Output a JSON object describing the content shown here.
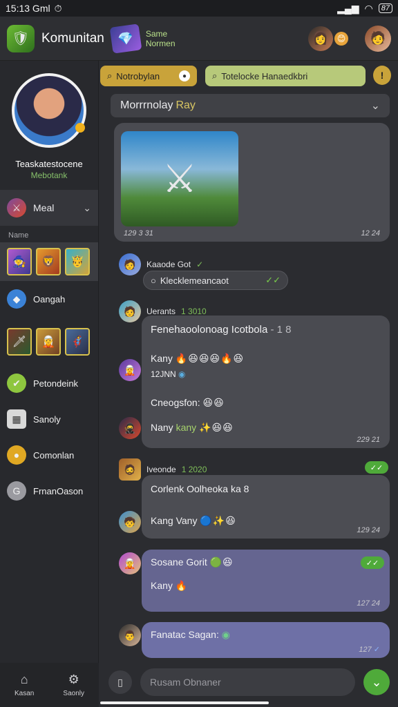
{
  "status": {
    "time": "15:13 Gml",
    "battery": "87"
  },
  "header": {
    "title": "Komunitan",
    "game_line1": "Same",
    "game_line2": "Normen"
  },
  "sidebar": {
    "name": "Teaskatestocene",
    "subtitle": "Mebotank",
    "meal_label": "Meal",
    "section_label": "Name",
    "items": [
      {
        "label": "Oangah",
        "icon": "diamond-icon",
        "color": "#3b82d6"
      },
      {
        "label": "Petondeink",
        "icon": "check-icon",
        "color": "#8ec63f"
      },
      {
        "label": "Sanoly",
        "icon": "calendar-icon",
        "color": "#d9d9d9"
      },
      {
        "label": "Comonlan",
        "icon": "trophy-icon",
        "color": "#e0a823"
      },
      {
        "label": "FrnanOason",
        "icon": "lock-icon",
        "color": "#9a9aa0"
      }
    ]
  },
  "filters": {
    "pill1": "Notrobylan",
    "pill2": "Totelocke Hanaedkbri",
    "info": "!"
  },
  "dropdown": {
    "label": "Morrrnolay",
    "highlight": "Ray"
  },
  "chat": {
    "card_meta_left": "129 3 31",
    "card_meta_right": "12 24",
    "msg1_name": "Kaaode Got",
    "tag_label": "Klecklemeancaot",
    "msg2_name": "Uerants",
    "msg2_time": "1 3010",
    "b1_title": "Fenehaoolonoag Icotbola",
    "b1_title_suffix": "- 1 8",
    "b1_line2": "Kany",
    "b1_line3": "12JNN",
    "b1_line4": "Cneogsfon:",
    "b1_line5": "Nany",
    "b1_line5_hl": "kany",
    "b1_time": "229 21",
    "msg3_name": "Iveonde",
    "msg3_time": "1 2020",
    "b2_line1": "Corlenk Oolheoka ka 8",
    "b2_line2": "Kang Vany",
    "b2_time": "129 24",
    "b3_line1": "Sosane Gorit",
    "b3_line2": "Kany",
    "b3_time": "127 24",
    "b4_line1": "Fanatac Sagan:",
    "b4_time": "127"
  },
  "input": {
    "placeholder": "Rusam Obnaner"
  },
  "nav": {
    "home": "Kasan",
    "settings": "Saonly"
  },
  "colors": {
    "accent_green": "#4faa3a",
    "accent_gold": "#c9a33a"
  }
}
